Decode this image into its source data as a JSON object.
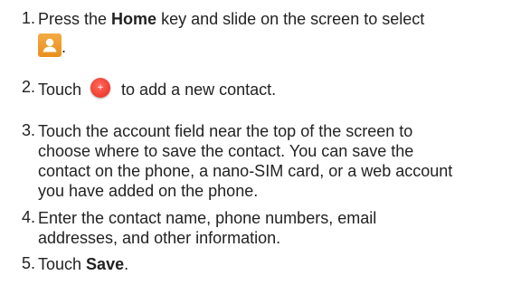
{
  "steps": [
    {
      "number": "1.",
      "pre": "Press the ",
      "bold": "Home",
      "post": " key and slide on the screen to select",
      "trail": "."
    },
    {
      "number": "2.",
      "pre": "Touch",
      "post": "to add a new contact."
    },
    {
      "number": "3.",
      "line1": "Touch the account field near the top of the screen to",
      "line2": "choose where to save the contact. You can save the",
      "line3": "contact on the phone, a nano-SIM card, or a web account",
      "line4": "you have added on the phone."
    },
    {
      "number": "4.",
      "line1": "Enter the contact name, phone numbers, email",
      "line2": "addresses, and other information."
    },
    {
      "number": "5.",
      "pre": "Touch ",
      "bold": "Save",
      "post": "."
    }
  ],
  "icons": {
    "contacts": "contacts-app-icon",
    "add": "add-contact-icon"
  },
  "colors": {
    "text": "#222222",
    "contacts_icon": "#ef9b2c",
    "add_button": "#ee3b2f"
  }
}
